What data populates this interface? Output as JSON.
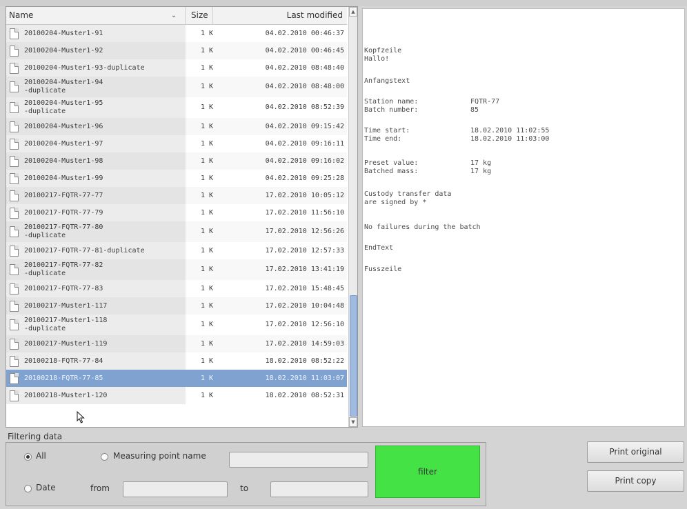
{
  "list": {
    "headers": {
      "name": "Name",
      "size": "Size",
      "modified": "Last modified"
    },
    "rows": [
      {
        "name": "20100204-Muster1-91",
        "size": "1 K",
        "modified": "04.02.2010 00:46:37"
      },
      {
        "name": "20100204-Muster1-92",
        "size": "1 K",
        "modified": "04.02.2010 00:46:45"
      },
      {
        "name": "20100204-Muster1-93-duplicate",
        "size": "1 K",
        "modified": "04.02.2010 08:48:40"
      },
      {
        "name": "20100204-Muster1-94\n-duplicate",
        "size": "1 K",
        "modified": "04.02.2010 08:48:00"
      },
      {
        "name": "20100204-Muster1-95\n-duplicate",
        "size": "1 K",
        "modified": "04.02.2010 08:52:39"
      },
      {
        "name": "20100204-Muster1-96",
        "size": "1 K",
        "modified": "04.02.2010 09:15:42"
      },
      {
        "name": "20100204-Muster1-97",
        "size": "1 K",
        "modified": "04.02.2010 09:16:11"
      },
      {
        "name": "20100204-Muster1-98",
        "size": "1 K",
        "modified": "04.02.2010 09:16:02"
      },
      {
        "name": "20100204-Muster1-99",
        "size": "1 K",
        "modified": "04.02.2010 09:25:28"
      },
      {
        "name": "20100217-FQTR-77-77",
        "size": "1 K",
        "modified": "17.02.2010 10:05:12"
      },
      {
        "name": "20100217-FQTR-77-79",
        "size": "1 K",
        "modified": "17.02.2010 11:56:10"
      },
      {
        "name": "20100217-FQTR-77-80\n-duplicate",
        "size": "1 K",
        "modified": "17.02.2010 12:56:26"
      },
      {
        "name": "20100217-FQTR-77-81-duplicate",
        "size": "1 K",
        "modified": "17.02.2010 12:57:33"
      },
      {
        "name": "20100217-FQTR-77-82\n-duplicate",
        "size": "1 K",
        "modified": "17.02.2010 13:41:19"
      },
      {
        "name": "20100217-FQTR-77-83",
        "size": "1 K",
        "modified": "17.02.2010 15:48:45"
      },
      {
        "name": "20100217-Muster1-117",
        "size": "1 K",
        "modified": "17.02.2010 10:04:48"
      },
      {
        "name": "20100217-Muster1-118\n-duplicate",
        "size": "1 K",
        "modified": "17.02.2010 12:56:10"
      },
      {
        "name": "20100217-Muster1-119",
        "size": "1 K",
        "modified": "17.02.2010 14:59:03"
      },
      {
        "name": "20100218-FQTR-77-84",
        "size": "1 K",
        "modified": "18.02.2010 08:52:22"
      },
      {
        "name": "20100218-FQTR-77-85",
        "size": "1 K",
        "modified": "18.02.2010 11:03:07"
      },
      {
        "name": "20100218-Muster1-120",
        "size": "1 K",
        "modified": "18.02.2010 08:52:31"
      }
    ],
    "selected_index": 19
  },
  "preview": {
    "lines": [
      {
        "label": "Kopfzeile",
        "value": ""
      },
      {
        "label": "Hallo!",
        "value": ""
      },
      {
        "label": "Anfangstext",
        "value": ""
      },
      {
        "label": "Station name:",
        "value": "FQTR-77"
      },
      {
        "label": "Batch number:",
        "value": "85"
      },
      {
        "label": "Time start:",
        "value": "18.02.2010 11:02:55"
      },
      {
        "label": "Time end:",
        "value": "18.02.2010 11:03:00"
      },
      {
        "label": "Preset value:",
        "value": "17 kg"
      },
      {
        "label": "Batched mass:",
        "value": "17 kg"
      },
      {
        "label": "Custody transfer data",
        "value": ""
      },
      {
        "label": "are signed by *",
        "value": ""
      },
      {
        "label": "No failures during the batch",
        "value": ""
      },
      {
        "label": "EndText",
        "value": ""
      },
      {
        "label": "Fusszeile",
        "value": ""
      }
    ]
  },
  "filter": {
    "title": "Filtering data",
    "all_label": "All",
    "measuring_point_label": "Measuring point name",
    "date_label": "Date",
    "from_label": "from",
    "to_label": "to",
    "filter_button": "filter",
    "measuring_point_value": "",
    "from_value": "",
    "to_value": "",
    "selected_option": "All"
  },
  "actions": {
    "print_original": "Print original",
    "print_copy": "Print copy"
  },
  "colors": {
    "filter_button": "#44e244",
    "selection": "#7fa2d0",
    "scroll_thumb": "#9fbbe0"
  }
}
